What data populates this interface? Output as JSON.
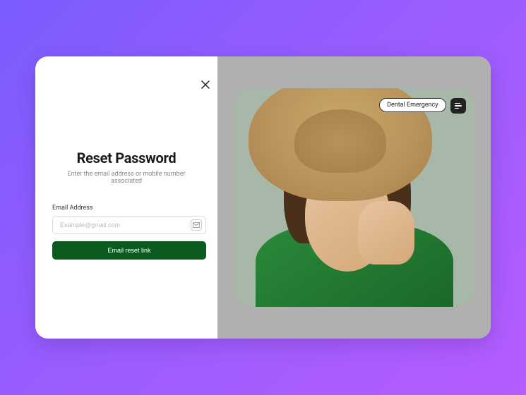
{
  "form": {
    "title": "Reset Password",
    "subtitle": "Enter the email address or mobile number associated",
    "emailLabel": "Email Address",
    "emailPlaceholder": "Example@gmail.com",
    "submitLabel": "Email reset link"
  },
  "hero": {
    "badge": "Dental Emergency"
  }
}
